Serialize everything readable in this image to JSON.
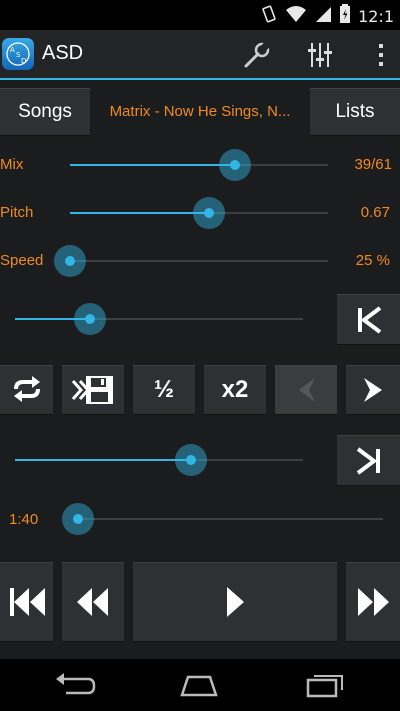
{
  "status_bar": {
    "time": "12:1"
  },
  "action_bar": {
    "app_title": "ASD",
    "app_icon_letters": "ASD"
  },
  "tabs": {
    "songs_label": "Songs",
    "track_title": "Matrix - Now He Sings, N...",
    "lists_label": "Lists"
  },
  "controls": {
    "mix": {
      "label": "Mix",
      "value": "39/61",
      "level": 0.64
    },
    "pitch": {
      "label": "Pitch",
      "value": "0.67",
      "level": 0.54
    },
    "speed": {
      "label": "Speed",
      "value": "25 %",
      "level": 0.0
    }
  },
  "loop": {
    "start_level": 0.26,
    "end_level": 0.61
  },
  "tool_buttons": {
    "half_label": "½",
    "double_label": "x2"
  },
  "playback": {
    "time": "1:40",
    "position_level": 0.0
  },
  "colors": {
    "accent": "#33b5e5",
    "value_text": "#f08a24",
    "background": "#1b1c1e",
    "button": "#2e3033"
  }
}
